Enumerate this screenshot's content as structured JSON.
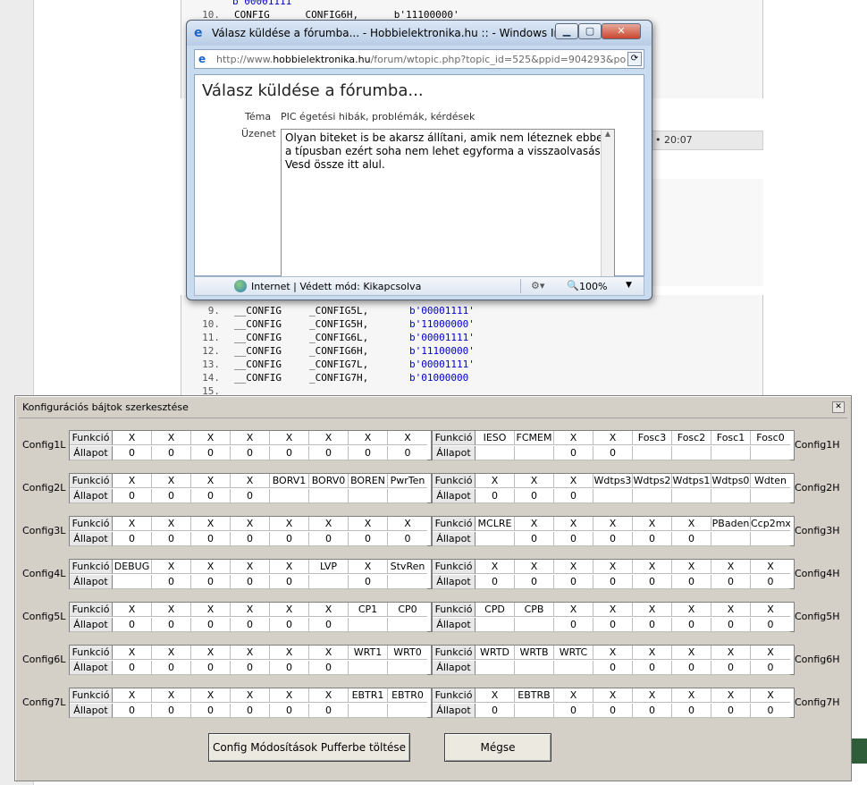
{
  "background": {
    "code_top": [
      {
        "ln": "",
        "text": "b'00001111'"
      },
      {
        "ln": "10.",
        "text": "CONFIG      CONFIG6H,      b'11100000'"
      }
    ],
    "code_bottom": [
      {
        "ln": "9.",
        "dir": "__CONFIG",
        "reg": "_CONFIG5L,",
        "val": "b'00001111'"
      },
      {
        "ln": "10.",
        "dir": "__CONFIG",
        "reg": "_CONFIG5H,",
        "val": "b'11000000'"
      },
      {
        "ln": "11.",
        "dir": "__CONFIG",
        "reg": "_CONFIG6L,",
        "val": "b'00001111'"
      },
      {
        "ln": "12.",
        "dir": "__CONFIG",
        "reg": "_CONFIG6H,",
        "val": "b'11100000'"
      },
      {
        "ln": "13.",
        "dir": "__CONFIG",
        "reg": "_CONFIG7L,",
        "val": "b'00001111'"
      },
      {
        "ln": "14.",
        "dir": "__CONFIG",
        "reg": "_CONFIG7H,",
        "val": "b'01000000"
      },
      {
        "ln": "15.",
        "dir": "",
        "reg": "",
        "val": ""
      }
    ],
    "post_time": "• 20:07",
    "bottom_status": "Internet | Védett mód: Kikapcsolva"
  },
  "popup": {
    "title": "Válasz küldése a fórumba... - Hobbielektronika.hu :: - Windows Interne...",
    "url_prefix": "http://www.",
    "url_host": "hobbielektronika.hu",
    "url_rest": "/forum/wtopic.php?topic_id=525&ppid=904293&po",
    "page_title": "Válasz küldése a fórumba...",
    "tema_label": "Téma",
    "tema_value": "PIC égetési hibák, problémák, kérdések",
    "uzenet_label": "Üzenet",
    "message": "Olyan biteket is be akarsz állítani, amik nem léteznek ebben a típusban ezért soha nem lehet egyforma a visszaolvasás. Vesd össze itt alul.",
    "status_text": "Internet | Védett mód: Kikapcsolva",
    "zoom": "100%"
  },
  "config_dialog": {
    "title": "Konfigurációs bájtok szerkesztése",
    "row_header_function": "Funkció",
    "row_header_state": "Állapot",
    "apply_button": "Config Módosítások Pufferbe töltése",
    "cancel_button": "Mégse",
    "left_groups": [
      {
        "name": "Config1L",
        "func": [
          "X",
          "X",
          "X",
          "X",
          "X",
          "X",
          "X",
          "X"
        ],
        "state": [
          "0",
          "0",
          "0",
          "0",
          "0",
          "0",
          "0",
          "0"
        ]
      },
      {
        "name": "Config2L",
        "func": [
          "X",
          "X",
          "X",
          "X",
          "BORV1",
          "BORV0",
          "BOREN",
          "PwrTen"
        ],
        "state": [
          "0",
          "0",
          "0",
          "0",
          "",
          "",
          "",
          ""
        ]
      },
      {
        "name": "Config3L",
        "func": [
          "X",
          "X",
          "X",
          "X",
          "X",
          "X",
          "X",
          "X"
        ],
        "state": [
          "0",
          "0",
          "0",
          "0",
          "0",
          "0",
          "0",
          "0"
        ]
      },
      {
        "name": "Config4L",
        "func": [
          "DEBUG",
          "X",
          "X",
          "X",
          "X",
          "LVP",
          "X",
          "StvRen"
        ],
        "state": [
          "",
          "0",
          "0",
          "0",
          "0",
          "",
          "0",
          ""
        ]
      },
      {
        "name": "Config5L",
        "func": [
          "X",
          "X",
          "X",
          "X",
          "X",
          "X",
          "CP1",
          "CP0"
        ],
        "state": [
          "0",
          "0",
          "0",
          "0",
          "0",
          "0",
          "",
          ""
        ]
      },
      {
        "name": "Config6L",
        "func": [
          "X",
          "X",
          "X",
          "X",
          "X",
          "X",
          "WRT1",
          "WRT0"
        ],
        "state": [
          "0",
          "0",
          "0",
          "0",
          "0",
          "0",
          "",
          ""
        ]
      },
      {
        "name": "Config7L",
        "func": [
          "X",
          "X",
          "X",
          "X",
          "X",
          "X",
          "EBTR1",
          "EBTR0"
        ],
        "state": [
          "0",
          "0",
          "0",
          "0",
          "0",
          "0",
          "",
          ""
        ]
      }
    ],
    "right_groups": [
      {
        "name": "Config1H",
        "func": [
          "IESO",
          "FCMEM",
          "X",
          "X",
          "Fosc3",
          "Fosc2",
          "Fosc1",
          "Fosc0"
        ],
        "state": [
          "",
          "",
          "0",
          "0",
          "",
          "",
          "",
          ""
        ]
      },
      {
        "name": "Config2H",
        "func": [
          "X",
          "X",
          "X",
          "Wdtps3",
          "Wdtps2",
          "Wdtps1",
          "Wdtps0",
          "Wdten"
        ],
        "state": [
          "0",
          "0",
          "0",
          "",
          "",
          "",
          "",
          ""
        ]
      },
      {
        "name": "Config3H",
        "func": [
          "MCLRE",
          "X",
          "X",
          "X",
          "X",
          "X",
          "PBaden",
          "Ccp2mx"
        ],
        "state": [
          "",
          "0",
          "0",
          "0",
          "0",
          "0",
          "",
          ""
        ]
      },
      {
        "name": "Config4H",
        "func": [
          "X",
          "X",
          "X",
          "X",
          "X",
          "X",
          "X",
          "X"
        ],
        "state": [
          "0",
          "0",
          "0",
          "0",
          "0",
          "0",
          "0",
          "0"
        ]
      },
      {
        "name": "Config5H",
        "func": [
          "CPD",
          "CPB",
          "X",
          "X",
          "X",
          "X",
          "X",
          "X"
        ],
        "state": [
          "",
          "",
          "0",
          "0",
          "0",
          "0",
          "0",
          "0"
        ]
      },
      {
        "name": "Config6H",
        "func": [
          "WRTD",
          "WRTB",
          "WRTC",
          "X",
          "X",
          "X",
          "X",
          "X"
        ],
        "state": [
          "",
          "",
          "",
          "0",
          "0",
          "0",
          "0",
          "0"
        ]
      },
      {
        "name": "Config7H",
        "func": [
          "X",
          "EBTRB",
          "X",
          "X",
          "X",
          "X",
          "X",
          "X"
        ],
        "state": [
          "0",
          "",
          "0",
          "0",
          "0",
          "0",
          "0",
          "0"
        ]
      }
    ]
  }
}
